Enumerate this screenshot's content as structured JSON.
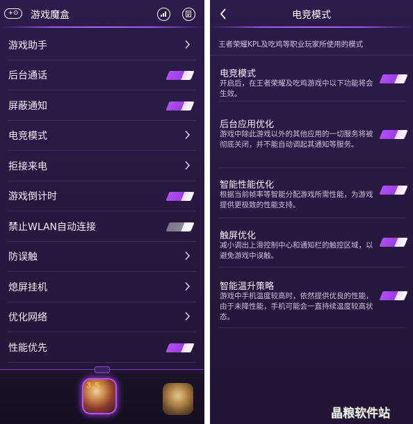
{
  "left": {
    "header": {
      "title": "游戏魔盒",
      "gamepad_text": "+⊙"
    },
    "items": [
      {
        "label": "游戏助手",
        "control": "chevron"
      },
      {
        "label": "后台通话",
        "control": "toggle-on"
      },
      {
        "label": "屏蔽通知",
        "control": "toggle-on"
      },
      {
        "label": "电竞模式",
        "control": "chevron"
      },
      {
        "label": "拒接来电",
        "control": "chevron"
      },
      {
        "label": "游戏倒计时",
        "control": "toggle-on"
      },
      {
        "label": "禁止WLAN自动连接",
        "control": "toggle-off"
      },
      {
        "label": "防误触",
        "control": "chevron"
      },
      {
        "label": "熄屏挂机",
        "control": "chevron"
      },
      {
        "label": "优化网络",
        "control": "chevron"
      },
      {
        "label": "性能优先",
        "control": "toggle-on"
      }
    ],
    "dock": {
      "game1_badge": "3.5"
    }
  },
  "right": {
    "header": {
      "title": "电竞模式"
    },
    "description": "王者荣耀KPL及吃鸡等职业玩家所使用的模式",
    "items": [
      {
        "title": "电竞模式",
        "desc": "开启后，在王者荣耀及吃鸡游戏中以下功能将会生效。",
        "on": true
      },
      {
        "title": "后台应用优化",
        "desc": "游戏中除此游戏以外的其他应用的一切服务将被彻底关闭，并不能自动调起其通知等服务。",
        "on": true
      },
      {
        "title": "智能性能优化",
        "desc": "根据当前帧率等智能分配游戏所需性能，为游戏提供更极致的性能支持。",
        "on": true
      },
      {
        "title": "触屏优化",
        "desc": "减小调出上滑控制中心和通知栏的触控区域，以避免游戏中误触。",
        "on": true
      },
      {
        "title": "智能温升策略",
        "desc": "游戏中手机温度较高时，依然提供优良的性能，由于未降性能，手机可能会一直持续温度较高状态。",
        "on": true
      }
    ]
  },
  "watermark": "晶粮软件站",
  "colors": {
    "toggle_on": "#a64ae8",
    "toggle_off": "#8d879a",
    "background": "#2a1a46",
    "divider": "#3d2b5c"
  }
}
